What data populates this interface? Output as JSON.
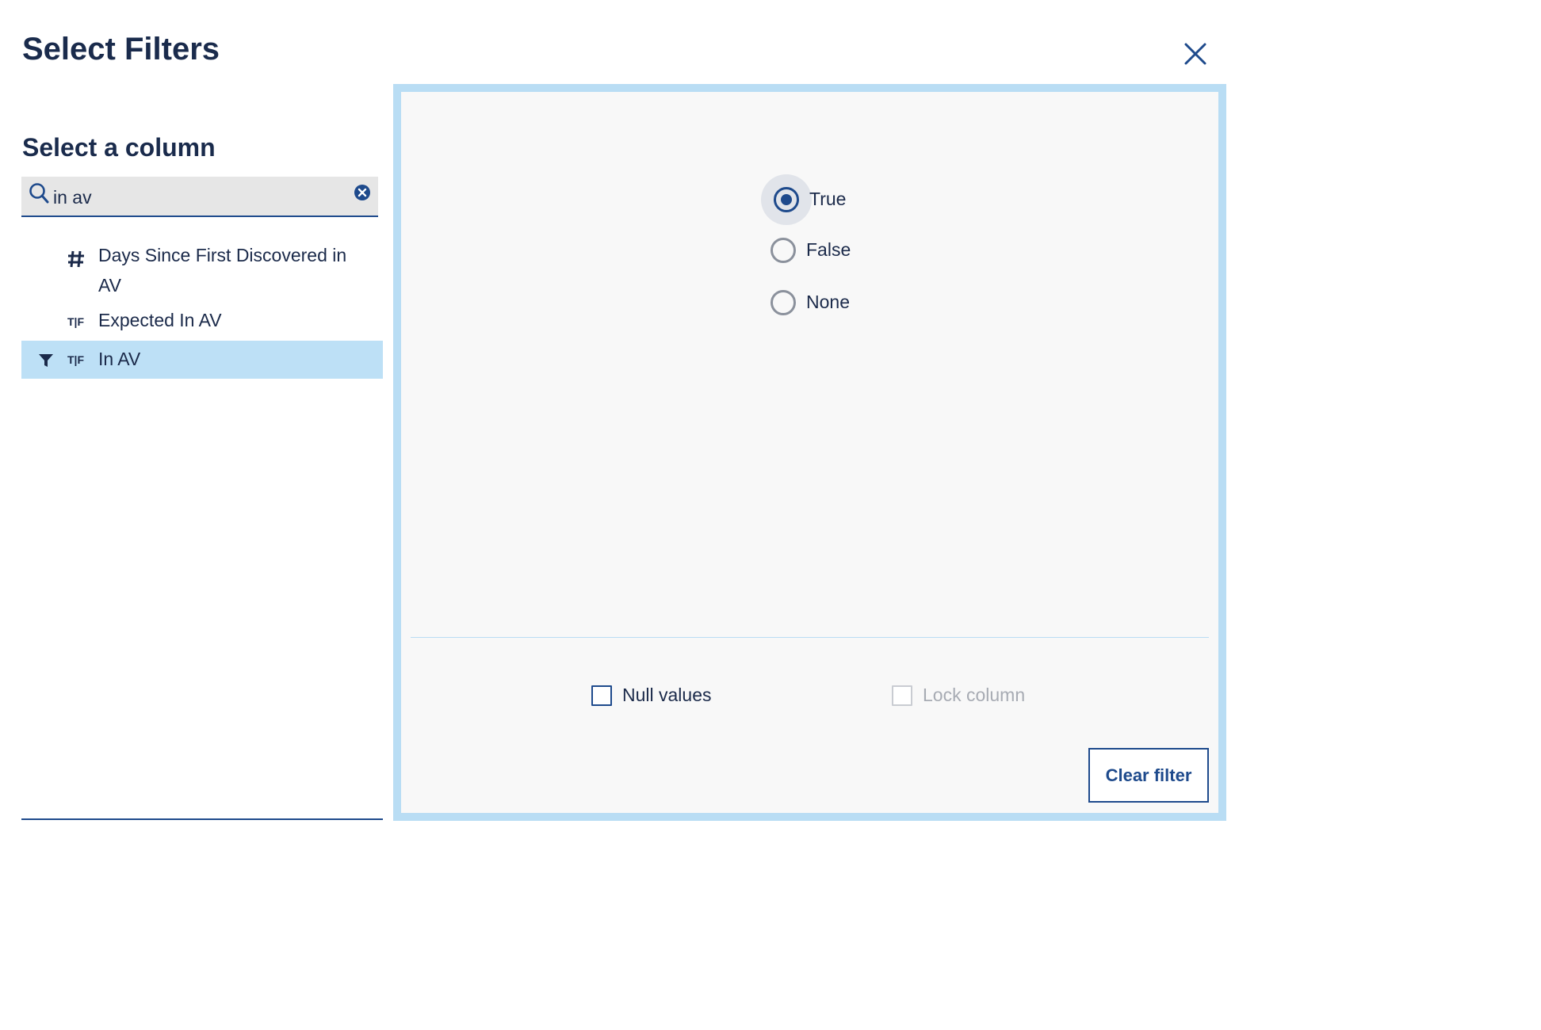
{
  "dialog": {
    "title": "Select Filters",
    "close_icon": "close-icon"
  },
  "column_picker": {
    "heading": "Select a column",
    "search": {
      "value": "in av",
      "placeholder": ""
    },
    "items": [
      {
        "label": "Days Since First Discovered in AV",
        "type_icon": "hash-icon",
        "filtered": false,
        "selected": false
      },
      {
        "label": "Expected In AV",
        "type_icon": "boolean-tf-icon",
        "filtered": false,
        "selected": false
      },
      {
        "label": "In AV",
        "type_icon": "boolean-tf-icon",
        "filtered": true,
        "selected": true
      }
    ],
    "tf_glyph": "T|F",
    "hash_glyph": "#"
  },
  "filter_panel": {
    "options": [
      {
        "label": "True",
        "checked": true
      },
      {
        "label": "False",
        "checked": false
      },
      {
        "label": "None",
        "checked": false
      }
    ],
    "null_values_label": "Null values",
    "null_values_checked": false,
    "lock_column_label": "Lock column",
    "lock_column_disabled": true,
    "clear_filter_label": "Clear filter"
  },
  "colors": {
    "primary": "#1e4a8c",
    "title": "#1a2b4c",
    "selected_row": "#bde0f6",
    "panel_border": "#b9ddf4",
    "panel_bg": "#f8f8f8"
  }
}
